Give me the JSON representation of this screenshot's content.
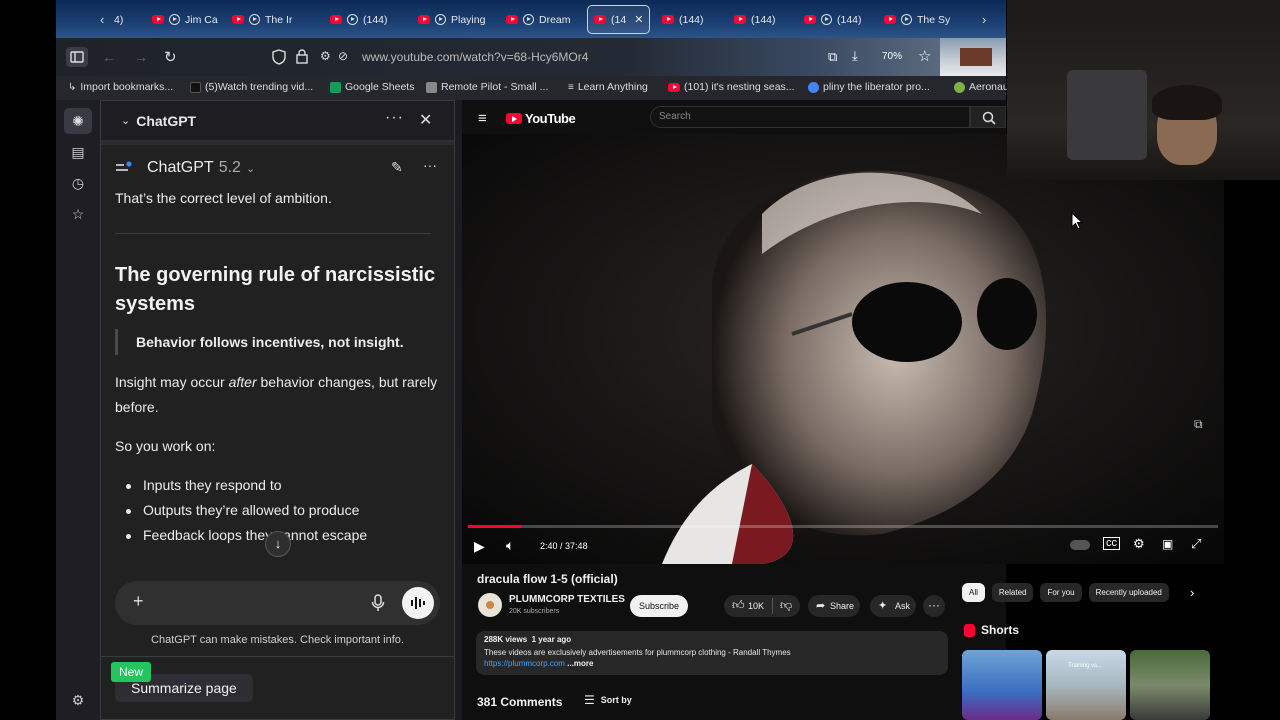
{
  "browser": {
    "tabs": [
      {
        "label": "4)",
        "kind": "partial"
      },
      {
        "label": "Jim Ca",
        "kind": "yt"
      },
      {
        "label": "The Ir",
        "kind": "yt"
      },
      {
        "label": "(144)",
        "kind": "yt"
      },
      {
        "label": "Playing",
        "kind": "yt"
      },
      {
        "label": "Dream",
        "kind": "yt"
      },
      {
        "label": "(14",
        "kind": "active"
      },
      {
        "label": "(144)",
        "kind": "yt"
      },
      {
        "label": "(144)",
        "kind": "yt"
      },
      {
        "label": "(144)",
        "kind": "yt"
      },
      {
        "label": "The Sy",
        "kind": "yt"
      }
    ],
    "url": "www.youtube.com/watch?v=68-Hcy6MOr4",
    "zoom": "70%",
    "bookmarks": [
      {
        "label": "Import bookmarks...",
        "color": "#9aa0a6"
      },
      {
        "label": "(5)Watch trending vid...",
        "color": "#111111"
      },
      {
        "label": "Google Sheets",
        "color": "#0f9d58"
      },
      {
        "label": "Remote Pilot - Small ...",
        "color": "#888888"
      },
      {
        "label": "Learn Anything",
        "color": "#bbbbbb"
      },
      {
        "label": "(101) it's nesting seas...",
        "color": "#ff0033"
      },
      {
        "label": "pliny the liberator pro...",
        "color": "#4285f4"
      },
      {
        "label": "Aeronau",
        "color": "#7cb342"
      }
    ]
  },
  "sidebar": {
    "title": "ChatGPT",
    "model_name": "ChatGPT",
    "model_version": "5.2",
    "intro_text": "That’s the correct level of ambition.",
    "heading": "The governing rule of narcissistic systems",
    "quote": "Behavior follows incentives, not insight.",
    "para1_a": "Insight may occur ",
    "para1_em": "after",
    "para1_b": " behavior changes, but rarely before.",
    "para2": "So you work on:",
    "bullets": [
      "Inputs they respond to",
      "Outputs they’re allowed to produce",
      "Feedback loops they cannot escape"
    ],
    "disclaimer": "ChatGPT can make mistakes. Check important info.",
    "new_badge": "New",
    "summarize_label": "Summarize page"
  },
  "youtube": {
    "logo": "YouTube",
    "search_placeholder": "Search",
    "time_current": "2:40",
    "time_total": "37:48",
    "progress": 0.0705,
    "title": "dracula flow 1-5 (official)",
    "channel": "PLUMMCORP TEXTILES",
    "subscribers": "20K subscribers",
    "subscribe": "Subscribe",
    "likes": "10K",
    "share": "Share",
    "ask": "Ask",
    "views": "288K views",
    "age": "1 year ago",
    "description": "These videos are exclusively advertisements for plummcorp clothing - Randall Thymes",
    "link": "https://plummcorp.com",
    "more": "...more",
    "comments": "381 Comments",
    "sort": "Sort by",
    "chips": [
      "All",
      "Related",
      "For you",
      "Recently uploaded"
    ],
    "shorts_title": "Shorts",
    "short2_text": "Training vs..."
  },
  "colors": {
    "accent_red": "#ff0033",
    "sidebar_bg": "#212121",
    "yt_bg": "#0f0f0f"
  }
}
